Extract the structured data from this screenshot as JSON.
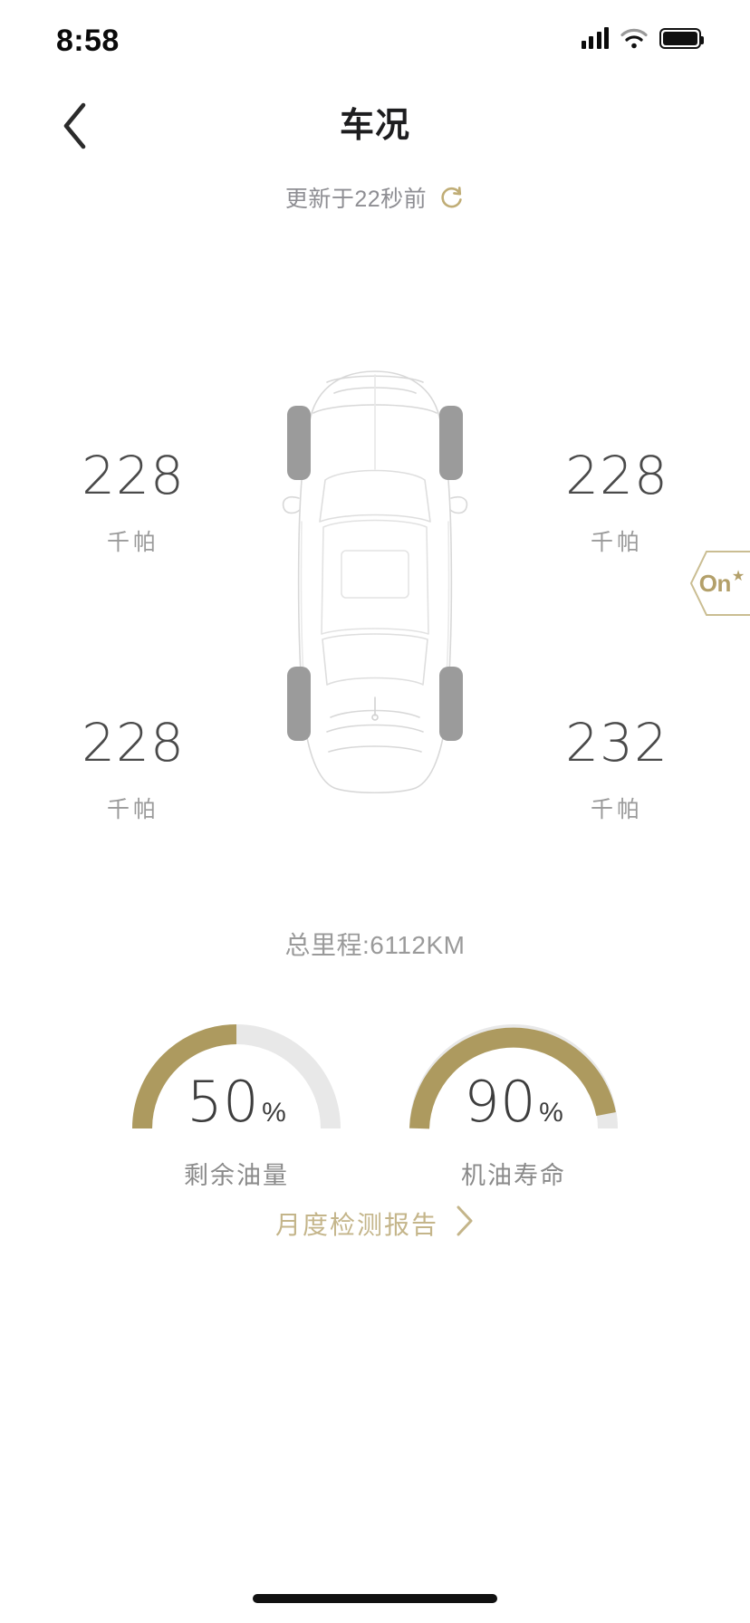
{
  "status_bar": {
    "time": "8:58",
    "signal_icon": "cellular-signal-icon",
    "wifi_icon": "wifi-icon",
    "battery_icon": "battery-full-icon"
  },
  "nav": {
    "back_icon": "chevron-left-icon",
    "title": "车况"
  },
  "refresh": {
    "text": "更新于22秒前",
    "icon": "refresh-icon"
  },
  "tyres": {
    "unit": "千帕",
    "front_left": {
      "value": "228",
      "unit": "千帕",
      "position": "front-left"
    },
    "front_right": {
      "value": "228",
      "unit": "千帕",
      "position": "front-right"
    },
    "rear_left": {
      "value": "228",
      "unit": "千帕",
      "position": "rear-left"
    },
    "rear_right": {
      "value": "232",
      "unit": "千帕",
      "position": "rear-right"
    }
  },
  "odometer": {
    "text": "总里程:6112KM"
  },
  "gauges": [
    {
      "value": "50",
      "percent_symbol": "%",
      "label": "剩余油量",
      "fill_ratio": 0.5,
      "track_color": "#e8e8e8",
      "fill_color": "#ad9a5f"
    },
    {
      "value": "90",
      "percent_symbol": "%",
      "label": "机油寿命",
      "fill_ratio": 0.9,
      "track_color": "#e8e8e8",
      "fill_color": "#ad9a5f"
    }
  ],
  "report_link": {
    "text": "月度检测报告",
    "chevron_icon": "chevron-right-icon",
    "color": "#c4b58a"
  },
  "onstar_badge": {
    "label": "On",
    "star": "★",
    "color": "#b3a06a"
  },
  "colors": {
    "accent_gold": "#ad9a5f",
    "text_primary": "#1d1d1f",
    "text_secondary": "#9a9a9a",
    "background": "#ffffff"
  }
}
